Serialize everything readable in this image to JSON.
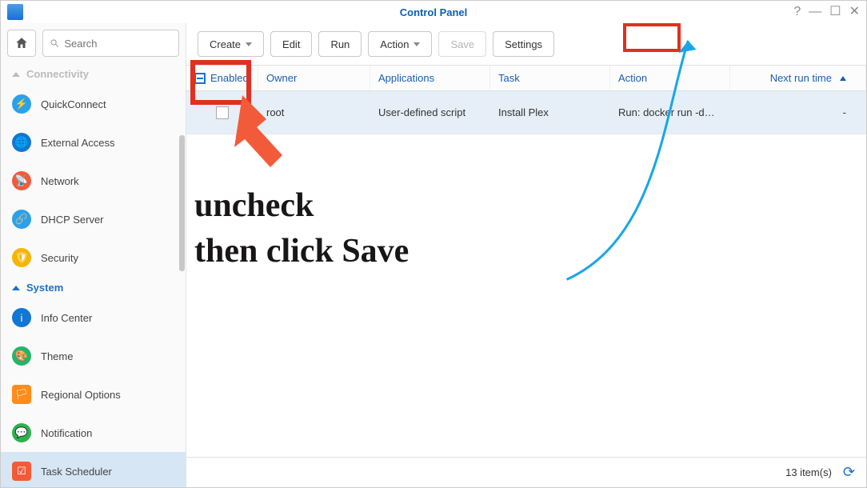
{
  "window": {
    "title": "Control Panel"
  },
  "search": {
    "placeholder": "Search"
  },
  "sidebar": {
    "groups": {
      "connectivity": {
        "label": "Connectivity"
      },
      "system": {
        "label": "System"
      }
    },
    "items": [
      {
        "label": "QuickConnect",
        "color": "#2aa1e8"
      },
      {
        "label": "External Access",
        "color": "#1276d4"
      },
      {
        "label": "Network",
        "color": "#f25b3a"
      },
      {
        "label": "DHCP Server",
        "color": "#2aa1e8"
      },
      {
        "label": "Security",
        "color": "#f7b500"
      },
      {
        "label": "Info Center",
        "color": "#1276d4"
      },
      {
        "label": "Theme",
        "color": "#27b36a"
      },
      {
        "label": "Regional Options",
        "color": "#ff8c1a"
      },
      {
        "label": "Notification",
        "color": "#2bb24c"
      },
      {
        "label": "Task Scheduler",
        "color": "#f25b3a"
      }
    ]
  },
  "toolbar": {
    "create": "Create",
    "edit": "Edit",
    "run": "Run",
    "action": "Action",
    "save": "Save",
    "settings": "Settings"
  },
  "table": {
    "headers": {
      "enabled": "Enabled",
      "owner": "Owner",
      "applications": "Applications",
      "task": "Task",
      "action": "Action",
      "next": "Next run time"
    },
    "rows": [
      {
        "enabled": false,
        "owner": "root",
        "applications": "User-defined script",
        "task": "Install Plex",
        "action": "Run: docker run -d…",
        "next": "-"
      }
    ]
  },
  "footer": {
    "count": "13 item(s)"
  },
  "annotation": {
    "line1": "uncheck",
    "line2": "then click Save"
  }
}
